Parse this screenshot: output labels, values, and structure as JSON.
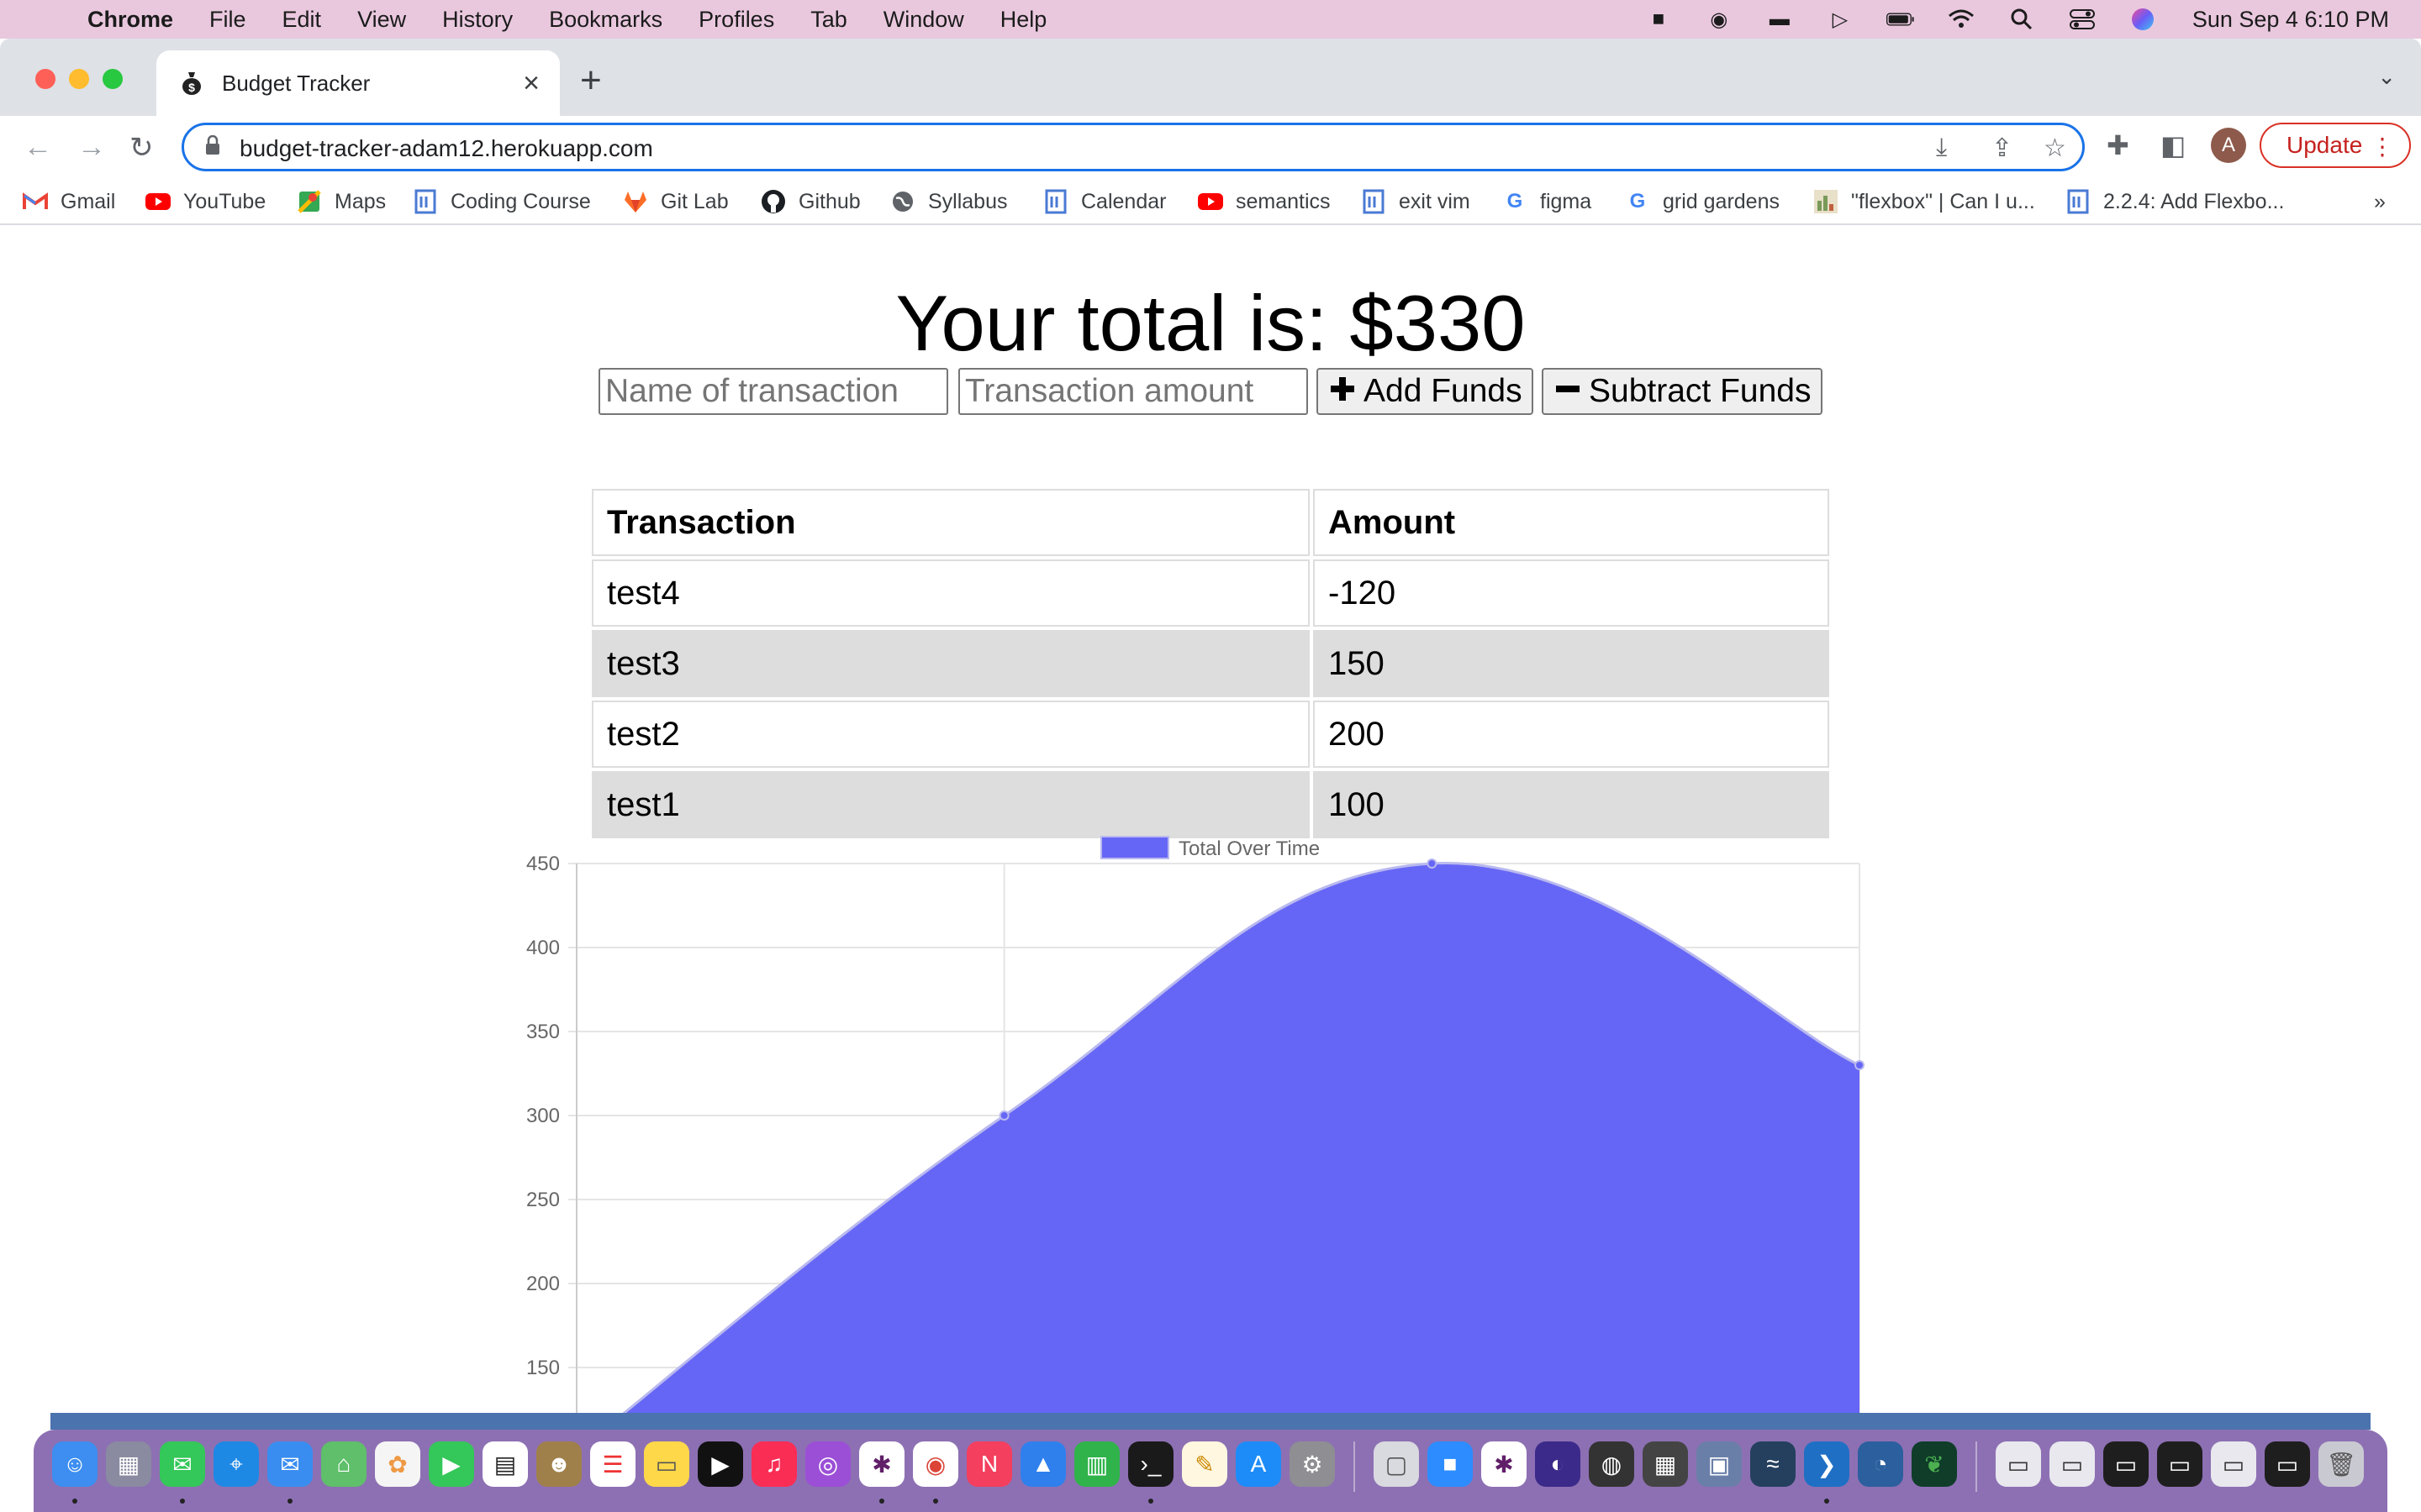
{
  "menubar": {
    "items": [
      "Chrome",
      "File",
      "Edit",
      "View",
      "History",
      "Bookmarks",
      "Profiles",
      "Tab",
      "Window",
      "Help"
    ],
    "clock": "Sun Sep 4  6:10 PM"
  },
  "browser": {
    "tab_title": "Budget Tracker",
    "url": "budget-tracker-adam12.herokuapp.com",
    "profile_initial": "A",
    "update_label": "Update",
    "bookmarks": [
      {
        "label": "Gmail",
        "icon": "gmail-icon"
      },
      {
        "label": "YouTube",
        "icon": "youtube-icon"
      },
      {
        "label": "Maps",
        "icon": "maps-icon"
      },
      {
        "label": "Coding Course",
        "icon": "page-icon"
      },
      {
        "label": "Git Lab",
        "icon": "gitlab-icon"
      },
      {
        "label": "Github",
        "icon": "github-icon"
      },
      {
        "label": "Syllabus",
        "icon": "globe-icon"
      },
      {
        "label": "Calendar",
        "icon": "page-icon"
      },
      {
        "label": "semantics",
        "icon": "youtube-icon"
      },
      {
        "label": "exit vim",
        "icon": "page-icon"
      },
      {
        "label": "figma",
        "icon": "google-icon"
      },
      {
        "label": "grid gardens",
        "icon": "google-icon"
      },
      {
        "label": "\"flexbox\" | Can I u...",
        "icon": "caniuse-icon"
      },
      {
        "label": "2.2.4: Add Flexbo...",
        "icon": "page-icon"
      }
    ],
    "bookmarks_overflow": "»"
  },
  "page": {
    "total_text": "Your total is: $330",
    "form": {
      "name_placeholder": "Name of transaction",
      "amount_placeholder": "Transaction amount",
      "add_label": "Add Funds",
      "subtract_label": "Subtract Funds"
    },
    "table": {
      "headers": [
        "Transaction",
        "Amount"
      ],
      "rows": [
        [
          "test4",
          "-120"
        ],
        [
          "test3",
          "150"
        ],
        [
          "test2",
          "200"
        ],
        [
          "test1",
          "100"
        ]
      ]
    }
  },
  "chart_data": {
    "type": "line",
    "fill": true,
    "series": [
      {
        "name": "Total Over Time",
        "values": [
          100,
          300,
          450,
          330
        ],
        "color": "#6666f6"
      }
    ],
    "x": [
      "",
      "",
      "",
      ""
    ],
    "y_ticks": [
      150,
      200,
      250,
      300,
      350,
      400,
      450
    ],
    "ylim": [
      100,
      450
    ],
    "legend_position": "top",
    "grid": true
  },
  "colors": {
    "menubar_bg": "#e9c8de",
    "focus_ring": "#1a73e8",
    "chart_fill": "#6666f6",
    "update_red": "#d93025",
    "striped_row": "#dddddd"
  }
}
